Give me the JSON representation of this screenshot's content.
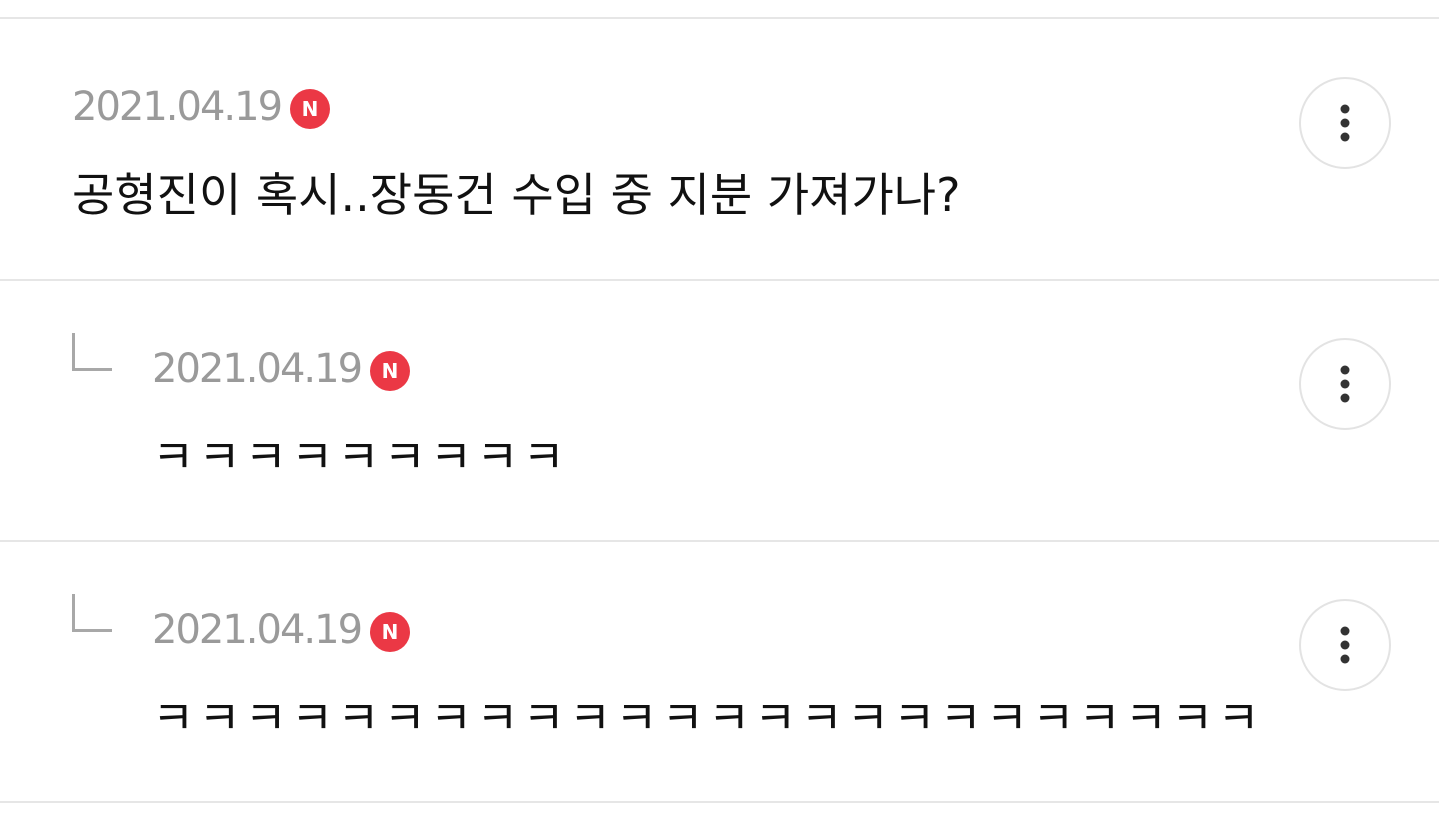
{
  "comments": [
    {
      "date": "2021.04.19",
      "badge": "N",
      "text": "공형진이 혹시..장동건 수입 중 지분 가져가나?",
      "is_reply": false
    },
    {
      "date": "2021.04.19",
      "badge": "N",
      "text": "ㅋㅋㅋㅋㅋㅋㅋㅋㅋ",
      "is_reply": true
    },
    {
      "date": "2021.04.19",
      "badge": "N",
      "text": "ㅋㅋㅋㅋㅋㅋㅋㅋㅋㅋㅋㅋㅋㅋㅋㅋㅋㅋㅋㅋㅋㅋㅋㅋ",
      "is_reply": true
    }
  ],
  "icons": {
    "more": "more-vertical-icon",
    "reply": "reply-arrow-icon"
  },
  "colors": {
    "badge": "#eb3845",
    "date": "#9a9a9a",
    "text": "#111111",
    "divider": "#e6e6e6"
  }
}
